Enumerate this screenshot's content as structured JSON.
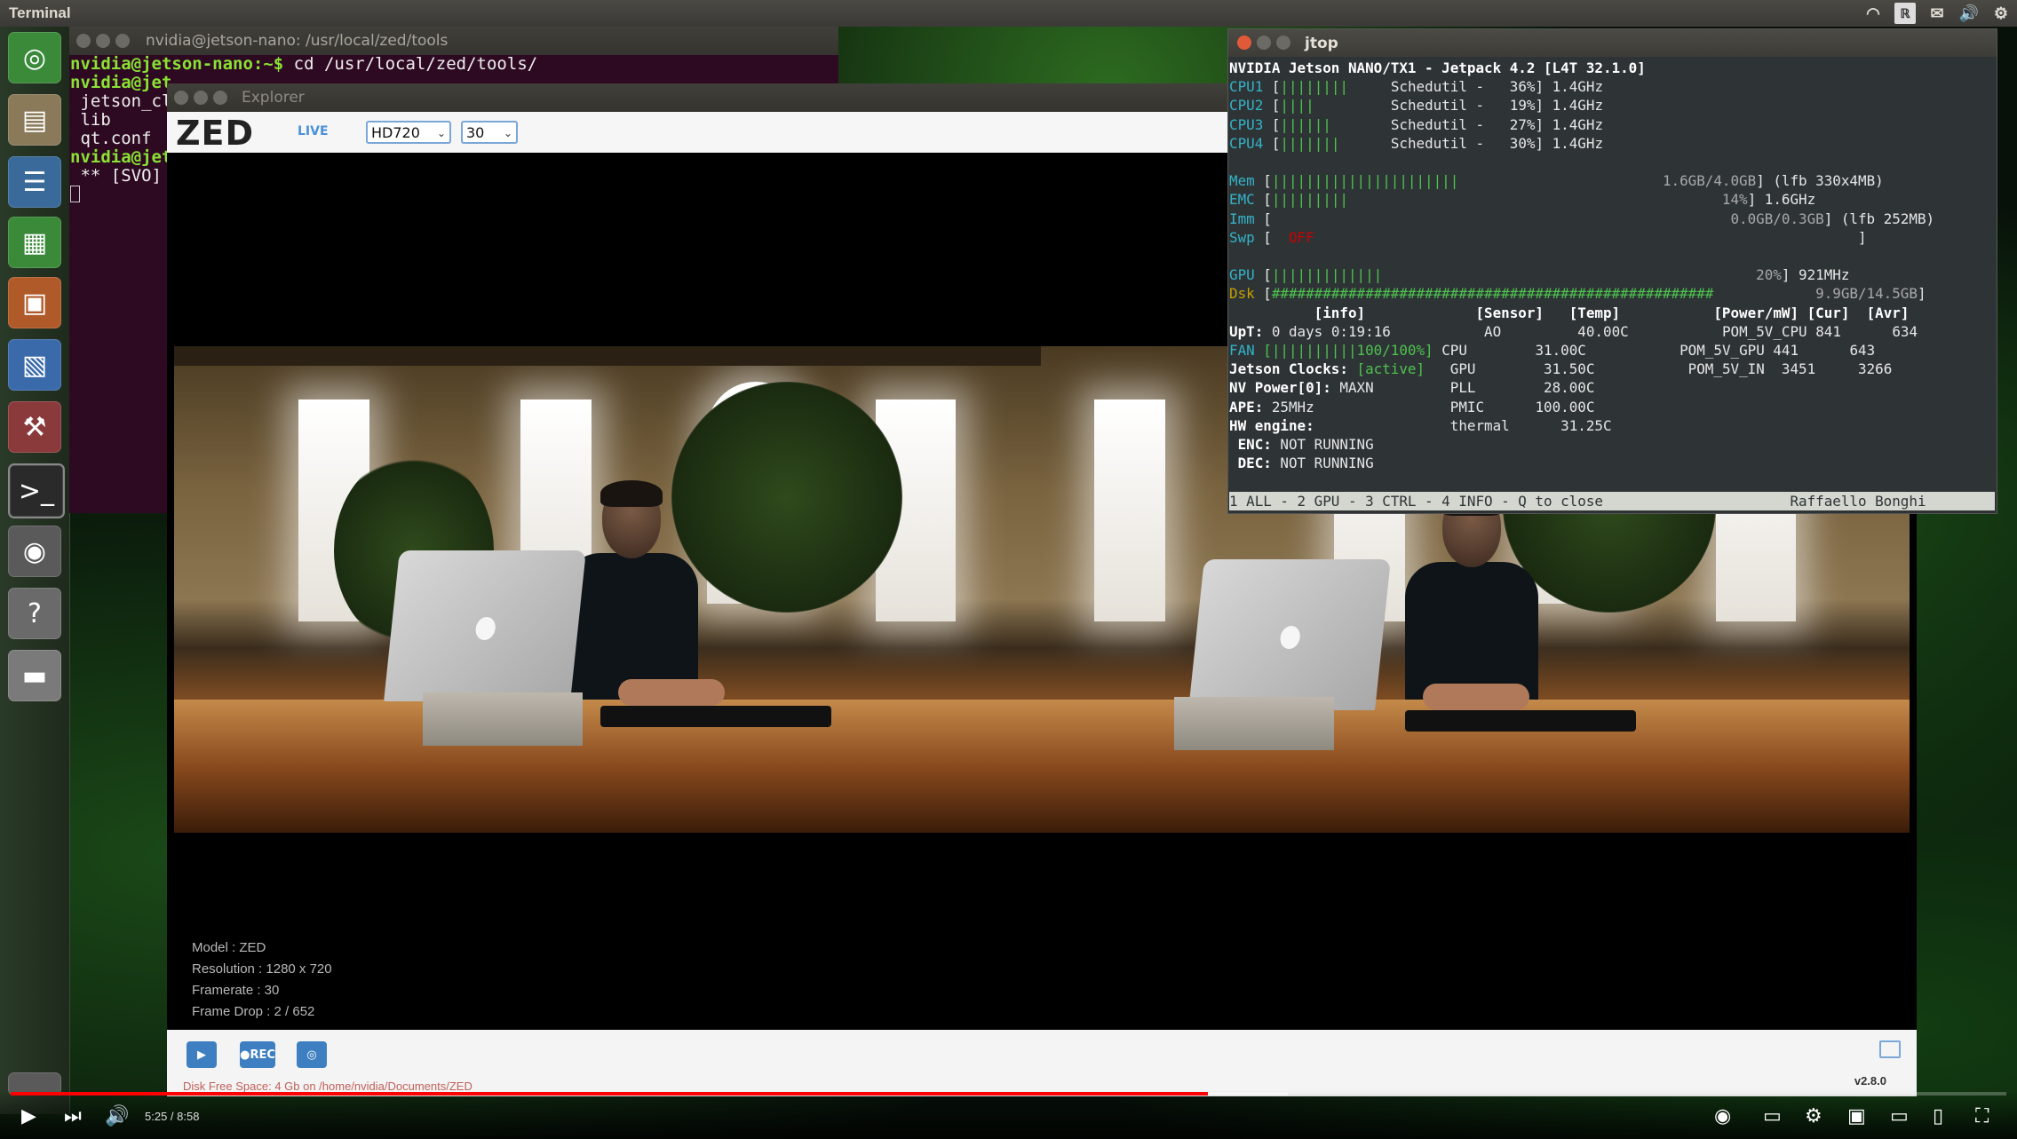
{
  "top_panel": {
    "title": "Terminal"
  },
  "terminal": {
    "title": "nvidia@jetson-nano: /usr/local/zed/tools",
    "lines": [
      {
        "prompt": "nvidia@jetson-nano:~$",
        "text": " cd /usr/local/zed/tools/"
      },
      {
        "prompt": "nvidia@jet",
        "text": ""
      },
      {
        "prompt": "",
        "text": " jetson_cl"
      },
      {
        "prompt": "",
        "text": " lib"
      },
      {
        "prompt": "",
        "text": " qt.conf"
      },
      {
        "prompt": "nvidia@jet",
        "text": ""
      },
      {
        "prompt": "",
        "text": " ** [SVO]"
      }
    ]
  },
  "explorer": {
    "title": "Explorer",
    "logo": "ZED",
    "live_label": "LIVE",
    "resolution_select": "HD720",
    "fps_select": "30",
    "info": {
      "model": "Model : ZED",
      "resolution": "Resolution : 1280 x 720",
      "framerate": "Framerate : 30",
      "frame_drop": "Frame Drop : 2 / 652"
    },
    "rec_label": "●REC",
    "disk_text": "Disk Free Space: 4 Gb  on /home/nvidia/Documents/ZED",
    "version": "v2.8.0"
  },
  "jtop": {
    "title": "jtop",
    "header": "NVIDIA Jetson NANO/TX1 - Jetpack 4.2 [L4T 32.1.0]",
    "cpus": [
      {
        "name": "CPU1",
        "bar": "||||||||",
        "gov": "Schedutil",
        "pct": "36%",
        "freq": "1.4GHz"
      },
      {
        "name": "CPU2",
        "bar": "||||",
        "gov": "Schedutil",
        "pct": "19%",
        "freq": "1.4GHz"
      },
      {
        "name": "CPU3",
        "bar": "||||||",
        "gov": "Schedutil",
        "pct": "27%",
        "freq": "1.4GHz"
      },
      {
        "name": "CPU4",
        "bar": "|||||||",
        "gov": "Schedutil",
        "pct": "30%",
        "freq": "1.4GHz"
      }
    ],
    "mem": {
      "bar": "||||||||||||||||||||||",
      "val": "1.6GB/4.0GB",
      "extra": "(lfb 330x4MB)"
    },
    "emc": {
      "bar": "|||||||||",
      "pct": "14%",
      "freq": "1.6GHz"
    },
    "imm": {
      "val": "0.0GB/0.3GB",
      "extra": "(lfb 252MB)"
    },
    "swp": {
      "val": "OFF"
    },
    "gpu": {
      "bar": "|||||||||||||",
      "pct": "20%",
      "freq": "921MHz"
    },
    "dsk": {
      "bar": "####################################################",
      "val": "9.9GB/14.5GB"
    },
    "info_head": "[info]",
    "sensor_head": "[Sensor]",
    "temp_head": "[Temp]",
    "power_head": "[Power/mW]",
    "cur_head": "[Cur]",
    "avr_head": "[Avr]",
    "info_lines": [
      {
        "k": "UpT:",
        "v": " 0 days 0:19:16",
        "sensor": "AO",
        "temp": "40.00C",
        "power": "POM_5V_CPU",
        "cur": "841",
        "avr": "634"
      },
      {
        "k": "FAN",
        "v": " [||||||||||100/100%]",
        "sensor": "CPU",
        "temp": "31.00C",
        "power": "POM_5V_GPU",
        "cur": "441",
        "avr": "643"
      },
      {
        "k": "Jetson Clocks:",
        "v": " [active]",
        "sensor": "GPU",
        "temp": "31.50C",
        "power": "POM_5V_IN",
        "cur": "3451",
        "avr": "3266"
      },
      {
        "k": "NV Power[0]:",
        "v": " MAXN",
        "sensor": "PLL",
        "temp": "28.00C",
        "power": "",
        "cur": "",
        "avr": ""
      },
      {
        "k": "APE:",
        "v": " 25MHz",
        "sensor": "PMIC",
        "temp": "100.00C",
        "power": "",
        "cur": "",
        "avr": ""
      },
      {
        "k": "HW engine:",
        "v": "",
        "sensor": "thermal",
        "temp": "31.25C",
        "power": "",
        "cur": "",
        "avr": ""
      },
      {
        "k": " ENC:",
        "v": " NOT RUNNING",
        "sensor": "",
        "temp": "",
        "power": "",
        "cur": "",
        "avr": ""
      },
      {
        "k": " DEC:",
        "v": " NOT RUNNING",
        "sensor": "",
        "temp": "",
        "power": "",
        "cur": "",
        "avr": ""
      }
    ],
    "status_bar": "1 ALL - 2 GPU - 3 CTRL - 4 INFO - Q to close",
    "author": "Raffaello Bonghi"
  },
  "player": {
    "time": "5:25 / 8:58",
    "progress": 0.6,
    "buffered": 0.64
  }
}
